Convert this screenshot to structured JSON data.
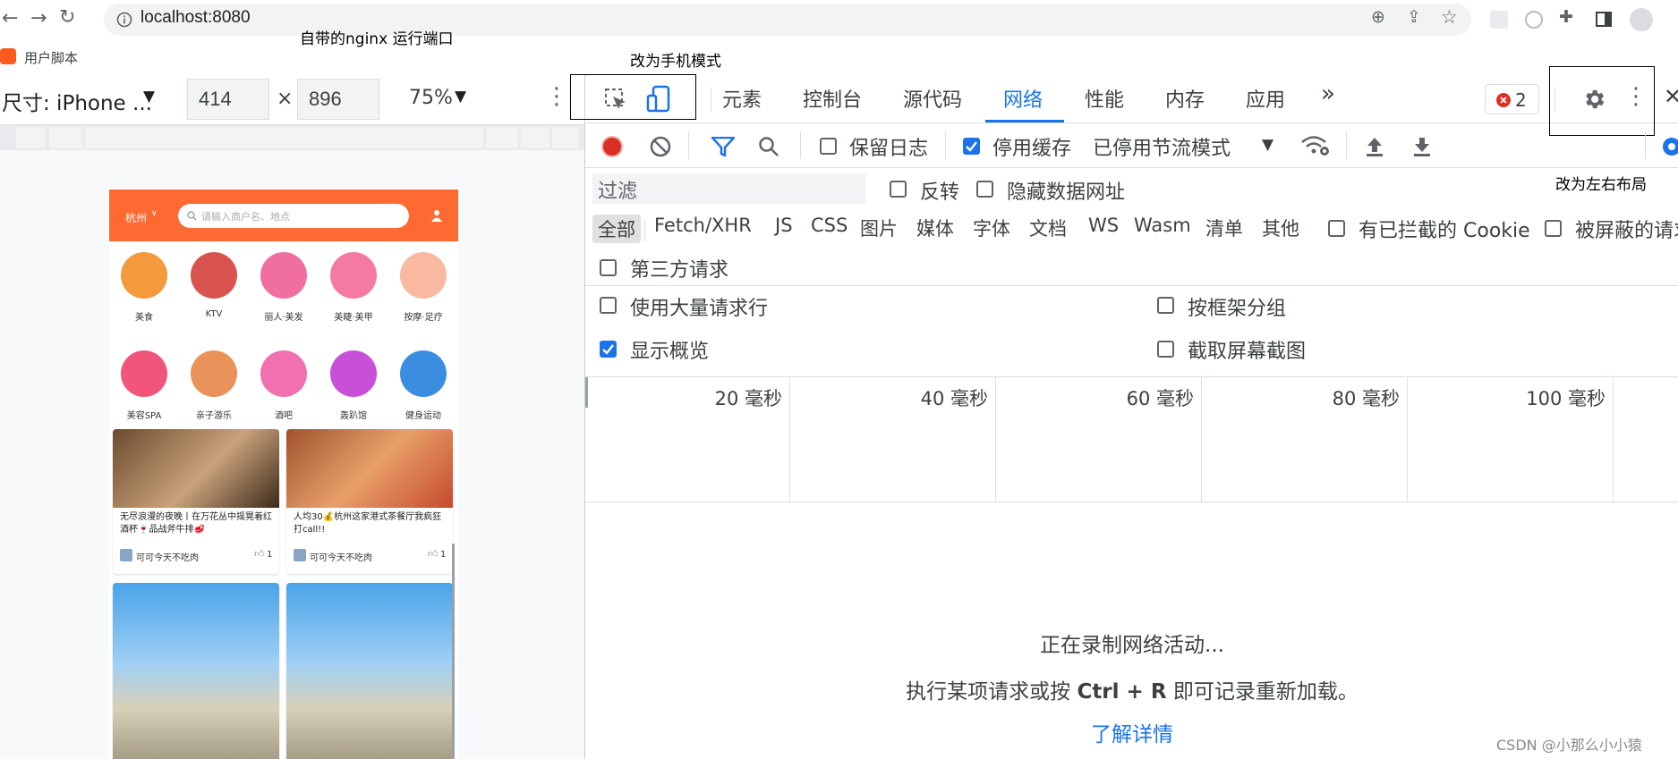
{
  "browser": {
    "url": "localhost:8080",
    "bookmark": "用户脚本"
  },
  "annotations": {
    "nginx_port": "自带的nginx 运行端口",
    "phone_mode": "改为手机模式",
    "layout": "改为左右布局"
  },
  "device_toolbar": {
    "device": "尺寸: iPhone ...",
    "width": "414",
    "times": "×",
    "height": "896",
    "zoom": "75%"
  },
  "phone": {
    "city": "杭州",
    "search_placeholder": "请输入商户名、地点",
    "categories": [
      {
        "label": "美食",
        "color": "#f39a3c"
      },
      {
        "label": "KTV",
        "color": "#d9534f"
      },
      {
        "label": "丽人·美发",
        "color": "#f06fa0"
      },
      {
        "label": "美睫·美甲",
        "color": "#f47aa4"
      },
      {
        "label": "按摩·足疗",
        "color": "#f8b9a0"
      },
      {
        "label": "美容SPA",
        "color": "#f2557a"
      },
      {
        "label": "亲子游乐",
        "color": "#e9935a"
      },
      {
        "label": "酒吧",
        "color": "#f070b0"
      },
      {
        "label": "轰趴馆",
        "color": "#c84fd8"
      },
      {
        "label": "健身运动",
        "color": "#3b8de0"
      }
    ],
    "cards": [
      {
        "title": "无尽浪漫的夜晚丨在万花丛中摇晃着红酒杯🍷品战斧牛排🥩",
        "user": "可可今天不吃肉",
        "likes": "1"
      },
      {
        "title": "人均30💰杭州这家港式茶餐厅我疯狂打call!!",
        "user": "可可今天不吃肉",
        "likes": "1"
      }
    ]
  },
  "devtools": {
    "tabs": [
      "元素",
      "控制台",
      "源代码",
      "网络",
      "性能",
      "内存",
      "应用"
    ],
    "active_tab": "网络",
    "more": "»",
    "error_count": "2",
    "toolbar": {
      "preserve_log": "保留日志",
      "disable_cache": "停用缓存",
      "throttle": "已停用节流模式"
    },
    "filter_placeholder": "过滤",
    "invert": "反转",
    "hide_data_urls": "隐藏数据网址",
    "types": [
      "全部",
      "Fetch/XHR",
      "JS",
      "CSS",
      "图片",
      "媒体",
      "字体",
      "文档",
      "WS",
      "Wasm",
      "清单",
      "其他"
    ],
    "blocked_cookies": "有已拦截的 Cookie",
    "blocked_requests": "被屏蔽的请求",
    "third_party": "第三方请求",
    "settings": {
      "large_rows": "使用大量请求行",
      "group_by_frame": "按框架分组",
      "show_overview": "显示概览",
      "capture_screenshots": "截取屏幕截图"
    },
    "timeline_ticks": [
      "20 毫秒",
      "40 毫秒",
      "60 毫秒",
      "80 毫秒",
      "100 毫秒"
    ],
    "empty": {
      "recording": "正在录制网络活动...",
      "hint_prefix": "执行某项请求或按 ",
      "hint_keys": "Ctrl + R",
      "hint_suffix": " 即可记录重新加载。",
      "learn_more": "了解详情"
    }
  },
  "watermark": "CSDN @小那么小小猿",
  "colors": {
    "accent": "#1a73e8",
    "record": "#d93025",
    "phone_header": "#ff6a33"
  }
}
